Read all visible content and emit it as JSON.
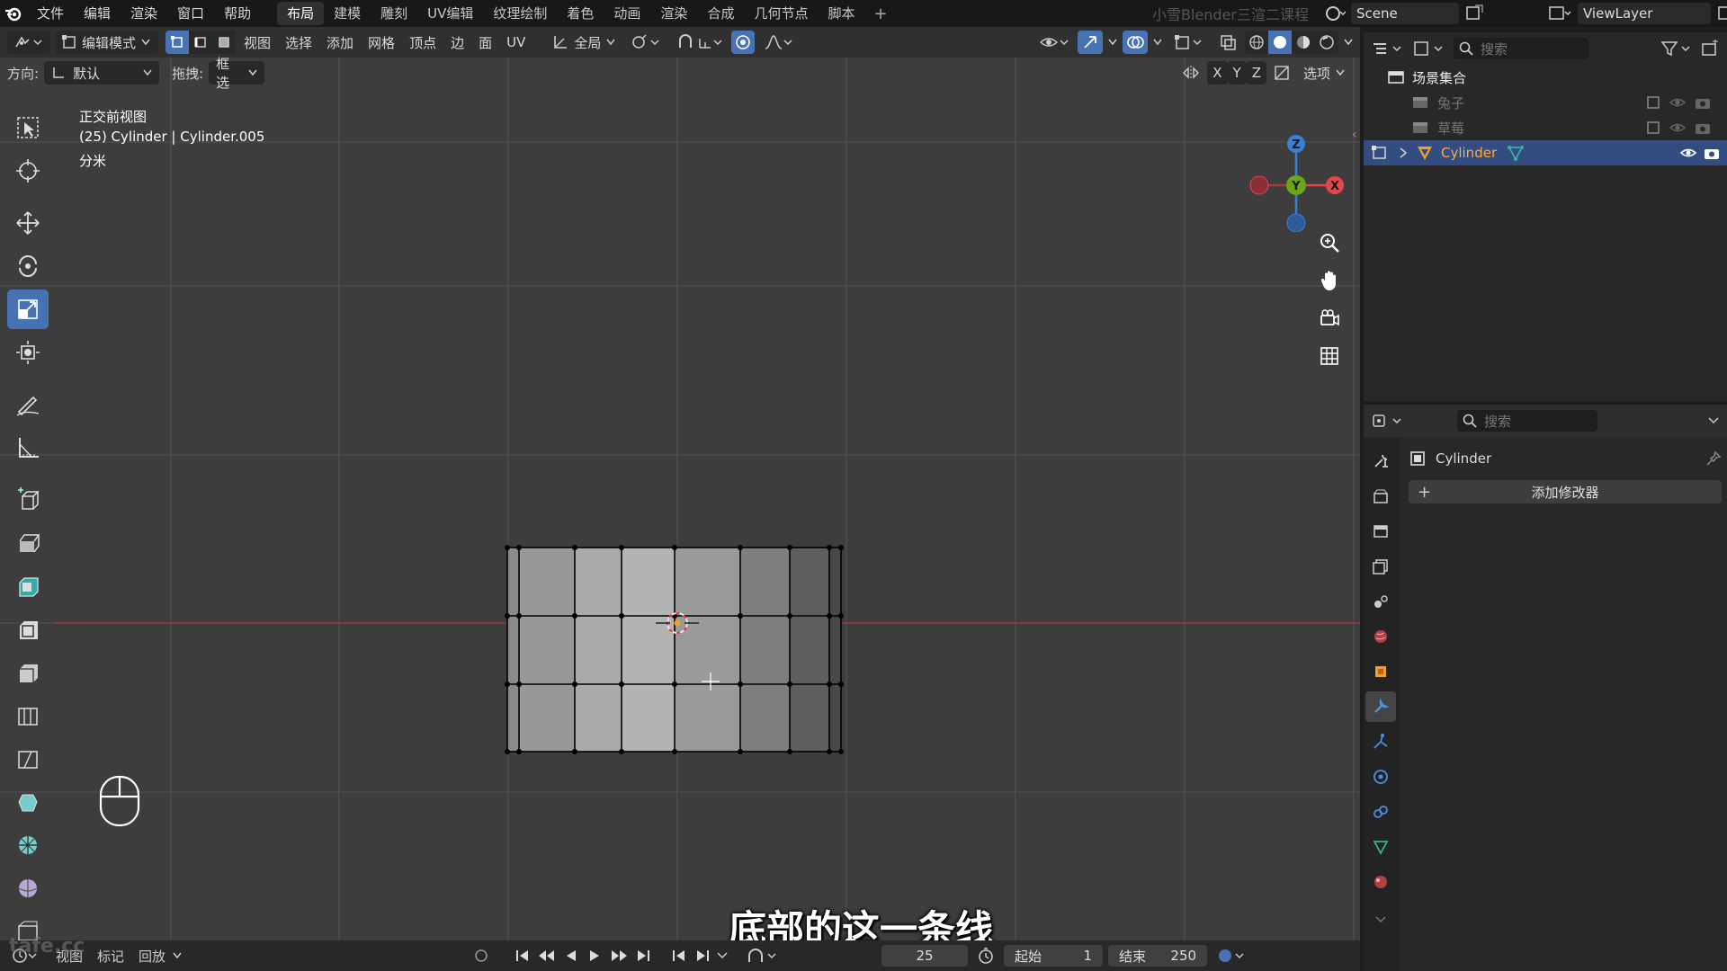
{
  "menubar": {
    "menus": [
      "文件",
      "编辑",
      "渲染",
      "窗口",
      "帮助"
    ],
    "workspaces": [
      "布局",
      "建模",
      "雕刻",
      "UV编辑",
      "纹理绘制",
      "着色",
      "动画",
      "渲染",
      "合成",
      "几何节点",
      "脚本"
    ],
    "active_workspace": "布局",
    "watermark": "小雪Blender三渲二课程",
    "scene": "Scene",
    "view_layer": "ViewLayer"
  },
  "viewport_header": {
    "mode": "编辑模式",
    "menus": [
      "视图",
      "选择",
      "添加",
      "网格",
      "顶点",
      "边",
      "面",
      "UV"
    ],
    "transform_orientation": "全局",
    "axis_labels": [
      "X",
      "Y",
      "Z"
    ],
    "options": "选项"
  },
  "tool_settings": {
    "orientation_label": "方向:",
    "orientation_value": "默认",
    "drag_label": "拖拽:",
    "drag_value": "框选"
  },
  "overlay": {
    "view_name": "正交前视图",
    "object_info": "(25) Cylinder | Cylinder.005",
    "unit": "分米"
  },
  "gizmo": {
    "z": "Z",
    "y": "Y",
    "x": "X"
  },
  "timeline": {
    "menus": [
      "视图",
      "标记",
      "回放"
    ],
    "current_frame": "25",
    "start_label": "起始",
    "start_value": "1",
    "end_label": "结束",
    "end_value": "250"
  },
  "subtitle": "底部的这一条线",
  "corner_watermark": "tafe.cc",
  "outliner": {
    "search_placeholder": "搜索",
    "collection": "场景集合",
    "items": [
      {
        "name": "兔子",
        "visible": false
      },
      {
        "name": "草莓",
        "visible": false
      },
      {
        "name": "Cylinder",
        "visible": true
      }
    ]
  },
  "properties": {
    "search_placeholder": "搜索",
    "object_name": "Cylinder",
    "add_modifier": "添加修改器"
  },
  "colors": {
    "accent": "#4772b3",
    "x_axis": "#e8444c",
    "y_axis": "#6aa61c",
    "z_axis": "#3b7ed3",
    "selected_text": "#ffaa40"
  }
}
